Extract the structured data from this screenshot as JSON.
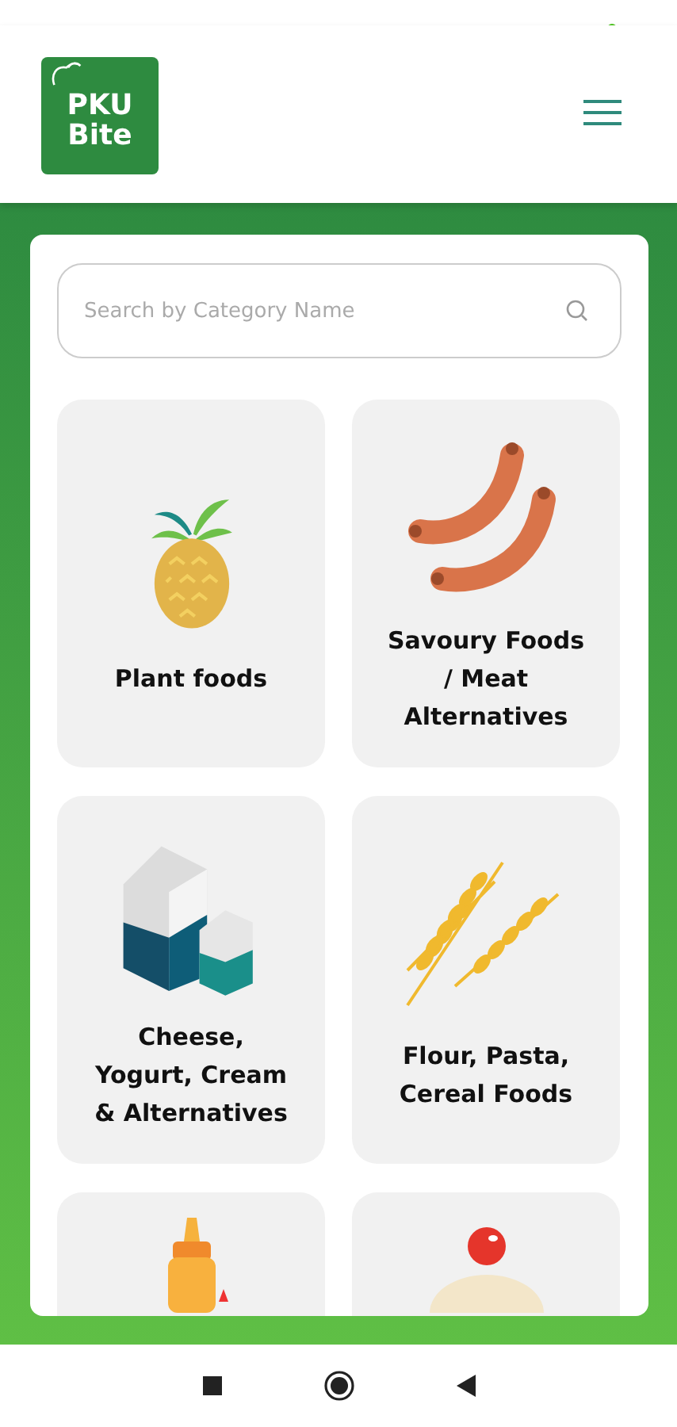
{
  "logo": {
    "line_1": "PKU",
    "line_2": "Bite"
  },
  "search": {
    "placeholder": "Search by Category Name"
  },
  "categories": [
    {
      "kind": "pineapple",
      "label": "Plant foods"
    },
    {
      "kind": "sausages",
      "label": "Savoury Foods / Meat Alternatives"
    },
    {
      "kind": "milk",
      "label": "Cheese, Yogurt, Cream & Alternatives"
    },
    {
      "kind": "wheat",
      "label": "Flour, Pasta, Cereal Foods"
    },
    {
      "kind": "bottle"
    },
    {
      "kind": "cupcake"
    }
  ]
}
